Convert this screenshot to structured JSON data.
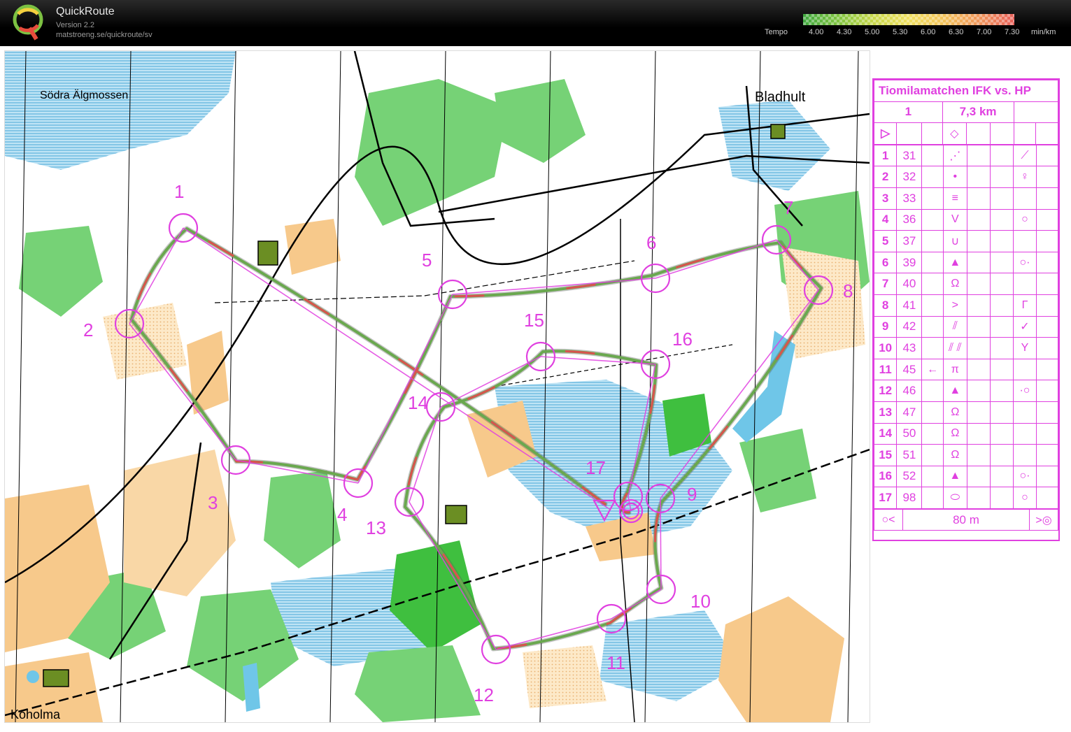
{
  "app": {
    "name": "QuickRoute",
    "version": "Version 2.2",
    "url": "matstroeng.se/quickroute/sv"
  },
  "tempo": {
    "label": "Tempo",
    "ticks": [
      "4.00",
      "4.30",
      "5.00",
      "5.30",
      "6.00",
      "6.30",
      "7.00",
      "7.30"
    ],
    "unit": "min/km"
  },
  "map": {
    "place_labels": [
      "Södra Älgmossen",
      "Bladhult",
      "Koholma"
    ],
    "control_numbers": [
      "1",
      "2",
      "3",
      "4",
      "5",
      "6",
      "7",
      "8",
      "9",
      "10",
      "11",
      "12",
      "13",
      "14",
      "15",
      "16",
      "17"
    ],
    "colors": {
      "course": "#e040e0",
      "route_slow": "#d9534f",
      "route_fast": "#6aa84f",
      "forest_green": "#5cc85c",
      "open_land": "#f7c98b",
      "water": "#6fc6e8"
    }
  },
  "legend": {
    "title": "Tiomilamatchen IFK vs. HP",
    "course": "1",
    "length": "7,3 km",
    "rows": [
      {
        "n": "1",
        "code": "31",
        "sym": "knoll-chain",
        "where": "",
        "detail": "corner"
      },
      {
        "n": "2",
        "code": "32",
        "sym": "•",
        "where": "",
        "detail": "o-top"
      },
      {
        "n": "3",
        "code": "33",
        "sym": "≡",
        "where": "",
        "detail": ""
      },
      {
        "n": "4",
        "code": "36",
        "sym": "V",
        "where": "",
        "detail": "○"
      },
      {
        "n": "5",
        "code": "37",
        "sym": "∪",
        "where": "",
        "detail": ""
      },
      {
        "n": "6",
        "code": "39",
        "sym": "▲",
        "where": "",
        "detail": "○·"
      },
      {
        "n": "7",
        "code": "40",
        "sym": "Ω",
        "where": "",
        "detail": ""
      },
      {
        "n": "8",
        "code": "41",
        "sym": ">",
        "where": "",
        "detail": "Γ"
      },
      {
        "n": "9",
        "code": "42",
        "sym": "////",
        "where": "",
        "detail": "✓"
      },
      {
        "n": "10",
        "code": "43",
        "sym": "//// ////",
        "where": "",
        "detail": "Y"
      },
      {
        "n": "11",
        "code": "45",
        "sym": "π",
        "where": "←",
        "detail": ""
      },
      {
        "n": "12",
        "code": "46",
        "sym": "▲",
        "where": "",
        "detail": "·○"
      },
      {
        "n": "13",
        "code": "47",
        "sym": "Ω",
        "where": "",
        "detail": ""
      },
      {
        "n": "14",
        "code": "50",
        "sym": "Ω",
        "where": "",
        "detail": ""
      },
      {
        "n": "15",
        "code": "51",
        "sym": "Ω",
        "where": "",
        "detail": ""
      },
      {
        "n": "16",
        "code": "52",
        "sym": "▲",
        "where": "",
        "detail": "○·"
      },
      {
        "n": "17",
        "code": "98",
        "sym": "⬭",
        "where": "",
        "detail": "○"
      }
    ],
    "finish_distance": "80 m"
  }
}
